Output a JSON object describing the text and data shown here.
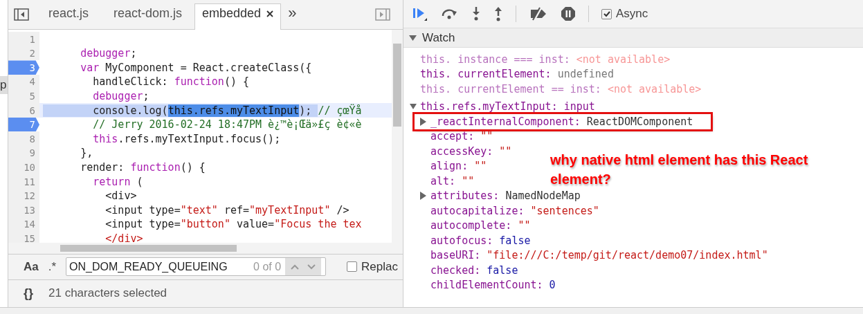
{
  "left_edge": {
    "text": "p"
  },
  "tabs": [
    {
      "label": "react.js",
      "selected": false
    },
    {
      "label": "react-dom.js",
      "selected": false
    },
    {
      "label": "embedded",
      "selected": true
    }
  ],
  "tabs_overflow": "»",
  "code_lines": [
    {
      "number": "1",
      "breakpoint": false,
      "current": false
    },
    {
      "number": "2",
      "breakpoint": false,
      "current": false,
      "tokens": [
        {
          "kind": "keyword",
          "text": "      debugger"
        },
        {
          "kind": "plain",
          "text": ";"
        }
      ]
    },
    {
      "number": "3",
      "breakpoint": true,
      "current": false,
      "tokens": [
        {
          "kind": "keyword",
          "text": "      var"
        },
        {
          "kind": "plain",
          "text": " MyComponent = React.createClass({"
        }
      ]
    },
    {
      "number": "4",
      "breakpoint": false,
      "current": false,
      "tokens": [
        {
          "kind": "plain",
          "text": "        handleClick: "
        },
        {
          "kind": "keyword",
          "text": "function"
        },
        {
          "kind": "plain",
          "text": "() {"
        }
      ]
    },
    {
      "number": "5",
      "breakpoint": false,
      "current": false,
      "tokens": [
        {
          "kind": "keyword",
          "text": "        debugger"
        },
        {
          "kind": "plain",
          "text": ";"
        }
      ]
    },
    {
      "number": "6",
      "breakpoint": false,
      "current": true,
      "tokens": [
        {
          "kind": "highlight",
          "text": "        console.log("
        },
        {
          "kind": "selection",
          "text": "this.refs.myTextInput"
        },
        {
          "kind": "highlight",
          "text": "); "
        },
        {
          "kind": "comment",
          "text": "// çœŸå"
        }
      ]
    },
    {
      "number": "7",
      "breakpoint": true,
      "current": false,
      "tokens": [
        {
          "kind": "comment",
          "text": "        // Jerry 2016-02-24 18:47PM è¿™è¡Œä»£ç è¢«è"
        }
      ]
    },
    {
      "number": "8",
      "breakpoint": false,
      "current": false,
      "tokens": [
        {
          "kind": "keyword",
          "text": "        this"
        },
        {
          "kind": "plain",
          "text": ".refs.myTextInput.focus();"
        }
      ]
    },
    {
      "number": "9",
      "breakpoint": false,
      "current": false,
      "tokens": [
        {
          "kind": "plain",
          "text": "      },"
        }
      ]
    },
    {
      "number": "10",
      "breakpoint": false,
      "current": false,
      "tokens": [
        {
          "kind": "plain",
          "text": "      render: "
        },
        {
          "kind": "keyword",
          "text": "function"
        },
        {
          "kind": "plain",
          "text": "() {"
        }
      ]
    },
    {
      "number": "11",
      "breakpoint": false,
      "current": false,
      "tokens": [
        {
          "kind": "keyword",
          "text": "        return"
        },
        {
          "kind": "plain",
          "text": " ("
        }
      ]
    },
    {
      "number": "12",
      "breakpoint": false,
      "current": false,
      "tokens": [
        {
          "kind": "plain",
          "text": "          <div>"
        }
      ]
    },
    {
      "number": "13",
      "breakpoint": false,
      "current": false,
      "tokens": [
        {
          "kind": "plain",
          "text": "          <input type="
        },
        {
          "kind": "string",
          "text": "\"text\""
        },
        {
          "kind": "plain",
          "text": " ref="
        },
        {
          "kind": "string",
          "text": "\"myTextInput\""
        },
        {
          "kind": "plain",
          "text": " />"
        }
      ]
    },
    {
      "number": "14",
      "breakpoint": false,
      "current": false,
      "tokens": [
        {
          "kind": "plain",
          "text": "          <input type="
        },
        {
          "kind": "string",
          "text": "\"button\""
        },
        {
          "kind": "plain",
          "text": " value="
        },
        {
          "kind": "string",
          "text": "\"Focus the tex"
        }
      ]
    },
    {
      "number": "15",
      "breakpoint": false,
      "current": false,
      "tokens": [
        {
          "kind": "string",
          "text": "          </div>"
        }
      ]
    }
  ],
  "search": {
    "case_button": "Aa",
    "regex_button": ".*",
    "value": "ON_DOM_READY_QUEUEING",
    "count": "0 of 0",
    "replace": {
      "label": "Replac",
      "checked": false
    }
  },
  "status_bar": {
    "format_button": "{}",
    "text": "21 characters selected"
  },
  "debug_toolbar": {
    "async": {
      "label": "Async",
      "checked": true
    }
  },
  "watch": {
    "title": "Watch",
    "expanded": true,
    "expressions": [
      {
        "name": "this. instance === inst:",
        "value": "<not available>",
        "kind": "error",
        "available": false
      },
      {
        "name": "this. currentElement:",
        "value": "undefined",
        "kind": "null",
        "available": true
      },
      {
        "name": "this. currentElement == inst:",
        "value": "<not available>",
        "kind": "error",
        "available": false
      }
    ],
    "object": {
      "name": "this.refs.myTextInput:",
      "value": "input",
      "expanded": true,
      "children": [
        {
          "name": "_reactInternalComponent:",
          "value": "ReactDOMComponent",
          "kind": "object",
          "expandable": true,
          "highlighted": true
        },
        {
          "name": "accept:",
          "value": "\"\"",
          "kind": "string",
          "expandable": false,
          "highlighted": false
        },
        {
          "name": "accessKey:",
          "value": "\"\"",
          "kind": "string",
          "expandable": false,
          "highlighted": false
        },
        {
          "name": "align:",
          "value": "\"\"",
          "kind": "string",
          "expandable": false,
          "highlighted": false
        },
        {
          "name": "alt:",
          "value": "\"\"",
          "kind": "string",
          "expandable": false,
          "highlighted": false
        },
        {
          "name": "attributes:",
          "value": "NamedNodeMap",
          "kind": "object",
          "expandable": true,
          "highlighted": false
        },
        {
          "name": "autocapitalize:",
          "value": "\"sentences\"",
          "kind": "string",
          "expandable": false,
          "highlighted": false
        },
        {
          "name": "autocomplete:",
          "value": "\"\"",
          "kind": "string",
          "expandable": false,
          "highlighted": false
        },
        {
          "name": "autofocus:",
          "value": "false",
          "kind": "boolean",
          "expandable": false,
          "highlighted": false
        },
        {
          "name": "baseURI:",
          "value": "\"file:///C:/temp/git/react/demo07/index.html\"",
          "kind": "string",
          "expandable": false,
          "highlighted": false
        },
        {
          "name": "checked:",
          "value": "false",
          "kind": "boolean",
          "expandable": false,
          "highlighted": false
        },
        {
          "name": "childElementCount:",
          "value": "0",
          "kind": "number",
          "expandable": false,
          "highlighted": false
        }
      ]
    }
  },
  "annotation": "why native html element has this React element?"
}
